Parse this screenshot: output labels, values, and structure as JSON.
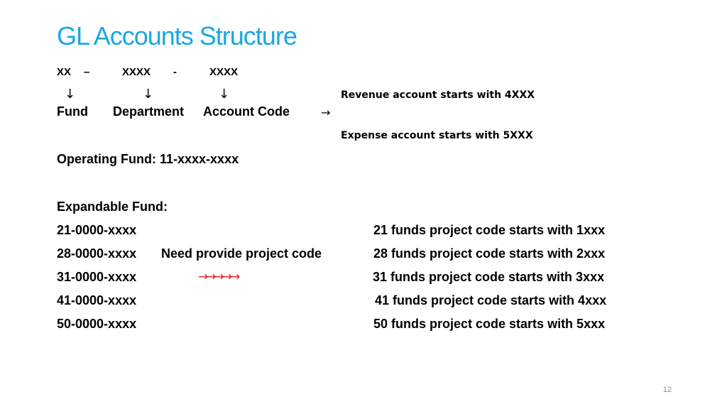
{
  "slide": {
    "title": "GL Accounts Structure",
    "pattern": {
      "seg1": "XX",
      "sep1": "–",
      "seg2": "XXXX",
      "sep2": "-",
      "seg3": "XXXX"
    },
    "down_arrow": "↓",
    "right_arrow": "→",
    "segments": {
      "fund": "Fund",
      "department": "Department",
      "account_code": "Account Code"
    },
    "account_notes": {
      "revenue": "Revenue account starts with 4XXX",
      "expense": "Expense account starts with 5XXX"
    },
    "operating_fund": "Operating Fund:  11-xxxx-xxxx",
    "expandable_fund": {
      "heading": "Expandable Fund:",
      "codes": [
        "21-0000-xxxx",
        "28-0000-xxxx",
        "31-0000-xxxx",
        "41-0000-xxxx",
        "50-0000-xxxx"
      ],
      "middle_note": "Need provide project code",
      "red_arrows": "→→→→→",
      "project_rules": [
        "21 funds project code starts with 1xxx",
        "28 funds project code starts with 2xxx",
        "31 funds project code starts with 3xxx",
        "41 funds project code starts with 4xxx",
        "50 funds project code starts with 5xxx"
      ]
    },
    "page_number": "12",
    "colors": {
      "title": "#1aa7e2",
      "arrows_accent": "#e02020"
    }
  }
}
